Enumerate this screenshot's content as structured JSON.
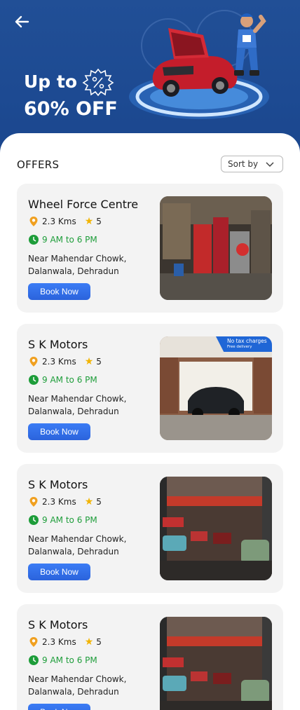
{
  "header": {
    "back_label": "Back",
    "promo_line1": "Up to",
    "promo_line2": "60% OFF"
  },
  "offers": {
    "title": "OFFERS",
    "sort_label": "Sort by"
  },
  "colors": {
    "header_blue": "#214f96",
    "accent_blue": "#2b63dc",
    "hours_green": "#1e9d3a",
    "star_yellow": "#f2b400",
    "pin_orange": "#f0a020",
    "card_bg": "#f3f3f3"
  },
  "cards": [
    {
      "name": "Wheel Force Centre",
      "distance": "2.3 Kms",
      "rating": "5",
      "hours": "9 AM to 6 PM",
      "address_line1": "Near Mahendar Chowk,",
      "address_line2": "Dalanwala, Dehradun",
      "cta": "Book Now",
      "image": "garage-workshop-photo"
    },
    {
      "name": "S K Motors",
      "distance": "2.3 Kms",
      "rating": "5",
      "hours": "9 AM to 6 PM",
      "address_line1": "Near Mahendar Chowk,",
      "address_line2": "Dalanwala, Dehradun",
      "cta": "Book Now",
      "image": "garage-car-photo",
      "badge_title": "No tax charges",
      "badge_sub": "Free delivery"
    },
    {
      "name": "S K Motors",
      "distance": "2.3 Kms",
      "rating": "5",
      "hours": "9 AM to 6 PM",
      "address_line1": "Near Mahendar Chowk,",
      "address_line2": "Dalanwala, Dehradun",
      "cta": "Book Now",
      "image": "classic-car-garage-photo"
    },
    {
      "name": "S K Motors",
      "distance": "2.3 Kms",
      "rating": "5",
      "hours": "9 AM to 6 PM",
      "address_line1": "Near Mahendar Chowk,",
      "address_line2": "Dalanwala, Dehradun",
      "cta": "Book Now",
      "image": "classic-car-garage-photo"
    }
  ]
}
